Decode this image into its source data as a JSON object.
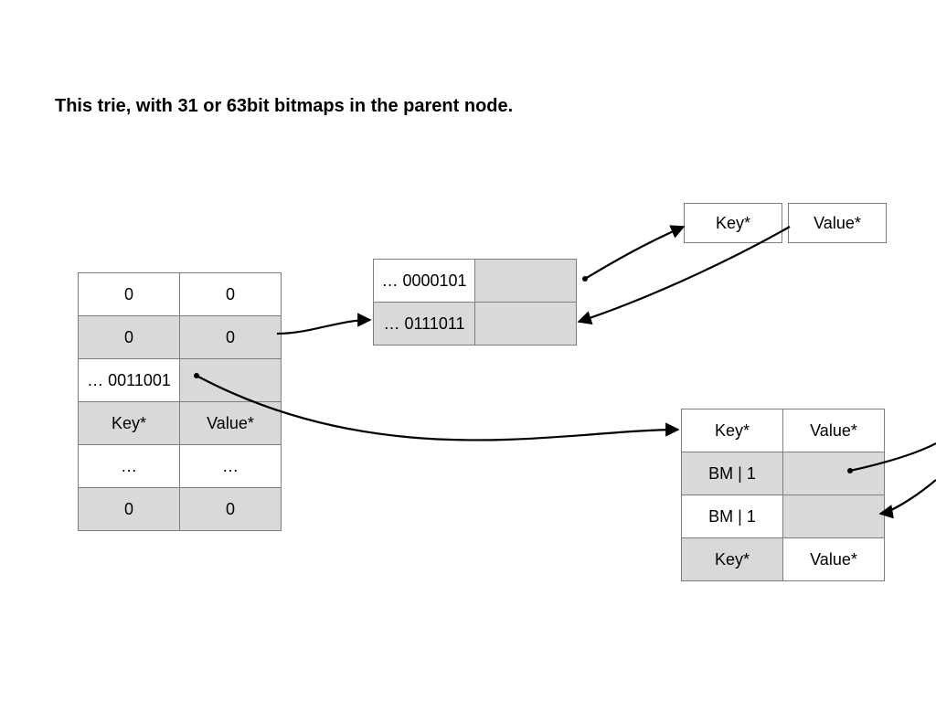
{
  "title": "This trie, with 31 or 63bit bitmaps in the parent node.",
  "top": {
    "key": "Key*",
    "value": "Value*"
  },
  "left": {
    "rows": [
      [
        "0",
        "0"
      ],
      [
        "0",
        "0"
      ],
      [
        "… 0011001",
        ""
      ],
      [
        "Key*",
        "Value*"
      ],
      [
        "…",
        "…"
      ],
      [
        "0",
        "0"
      ]
    ]
  },
  "mid": {
    "rows": [
      [
        "… 0000101",
        ""
      ],
      [
        "… 0111011",
        ""
      ]
    ]
  },
  "right": {
    "rows": [
      [
        "Key*",
        "Value*"
      ],
      [
        "BM | 1",
        ""
      ],
      [
        "BM | 1",
        ""
      ],
      [
        "Key*",
        "Value*"
      ]
    ]
  }
}
